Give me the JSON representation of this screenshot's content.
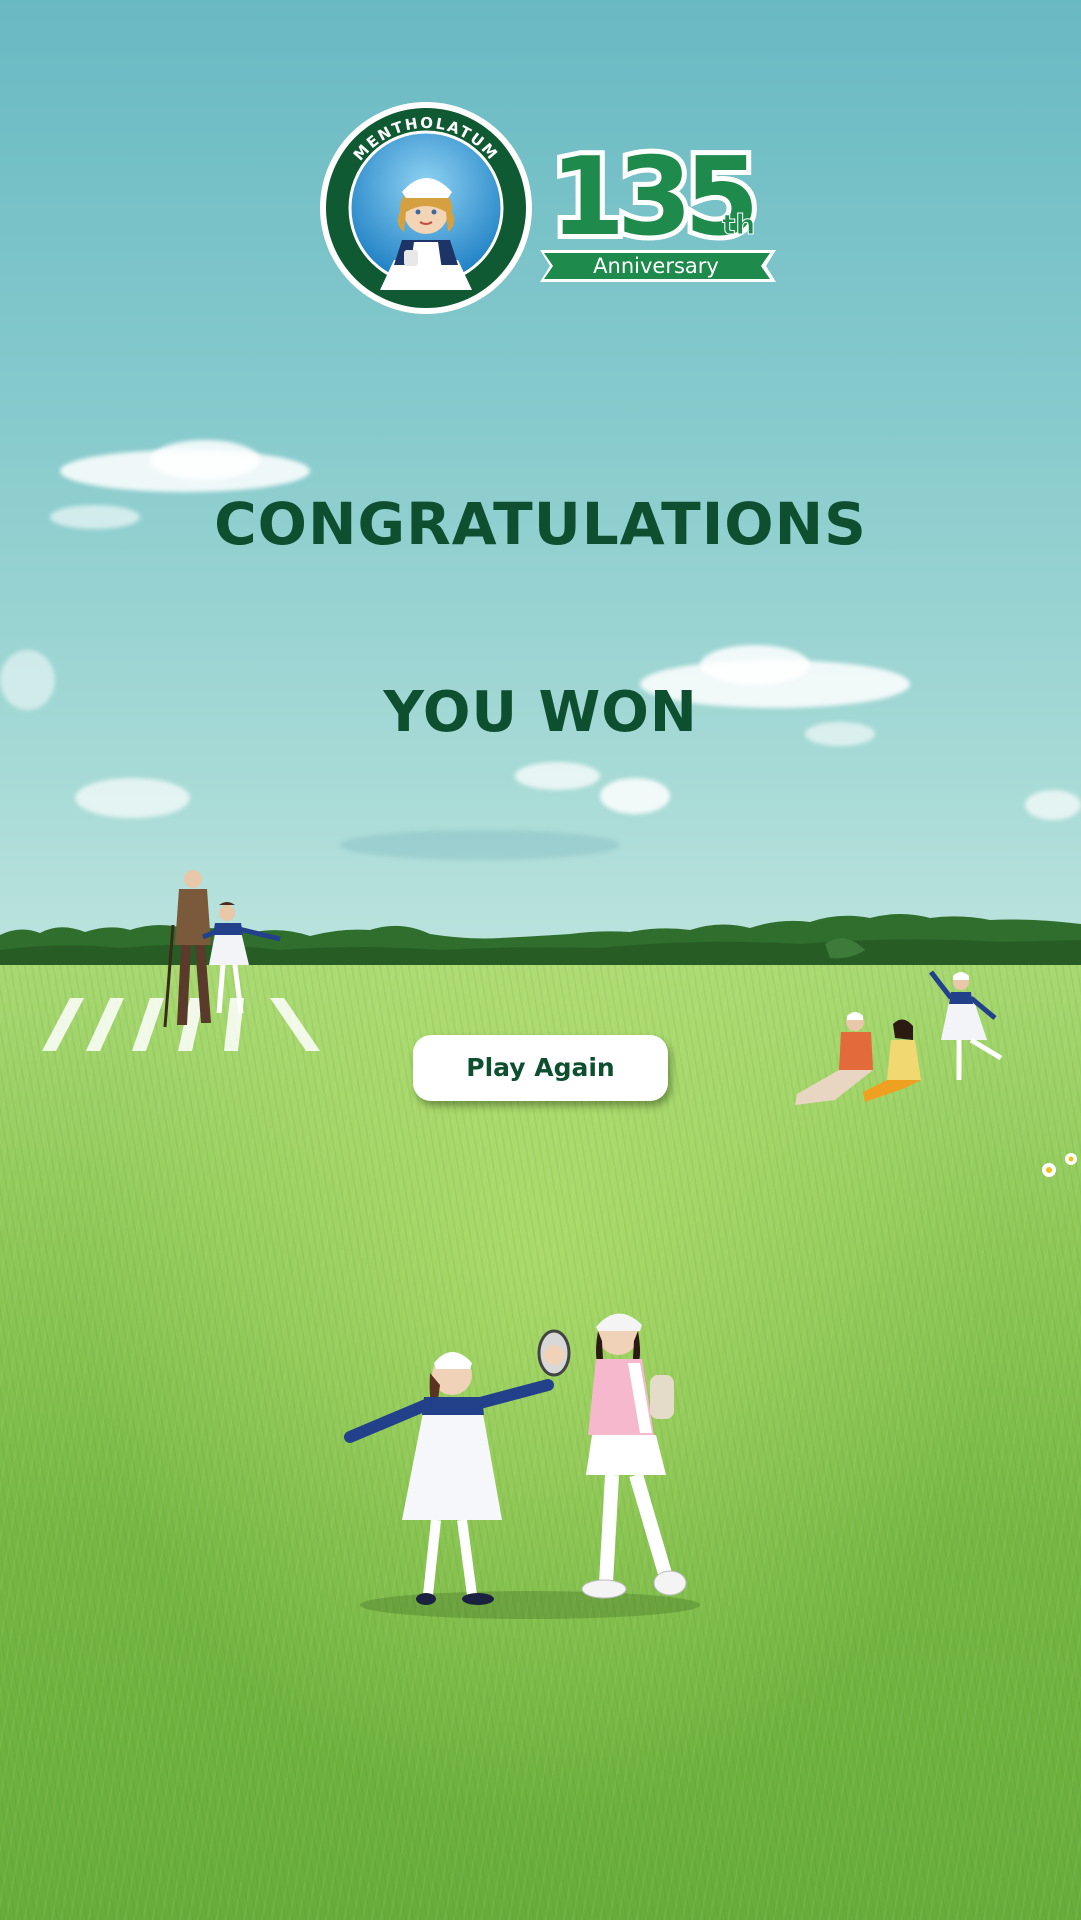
{
  "logo": {
    "brand_ring_text": "MENTHOLATUM",
    "anniversary_number": "135",
    "anniversary_suffix": "th",
    "anniversary_label": "Anniversary",
    "colors": {
      "green": "#1e8a4c",
      "dark_green": "#0d4f2f",
      "seal_blue": "#1d7fc4"
    }
  },
  "headline": {
    "congratulations": "CONGRATULATIONS",
    "result": "YOU WON"
  },
  "actions": {
    "play_again_label": "Play Again"
  },
  "colors": {
    "headline": "#0d4f2f",
    "sky_top": "#69b9c3",
    "grass": "#8ec858"
  }
}
